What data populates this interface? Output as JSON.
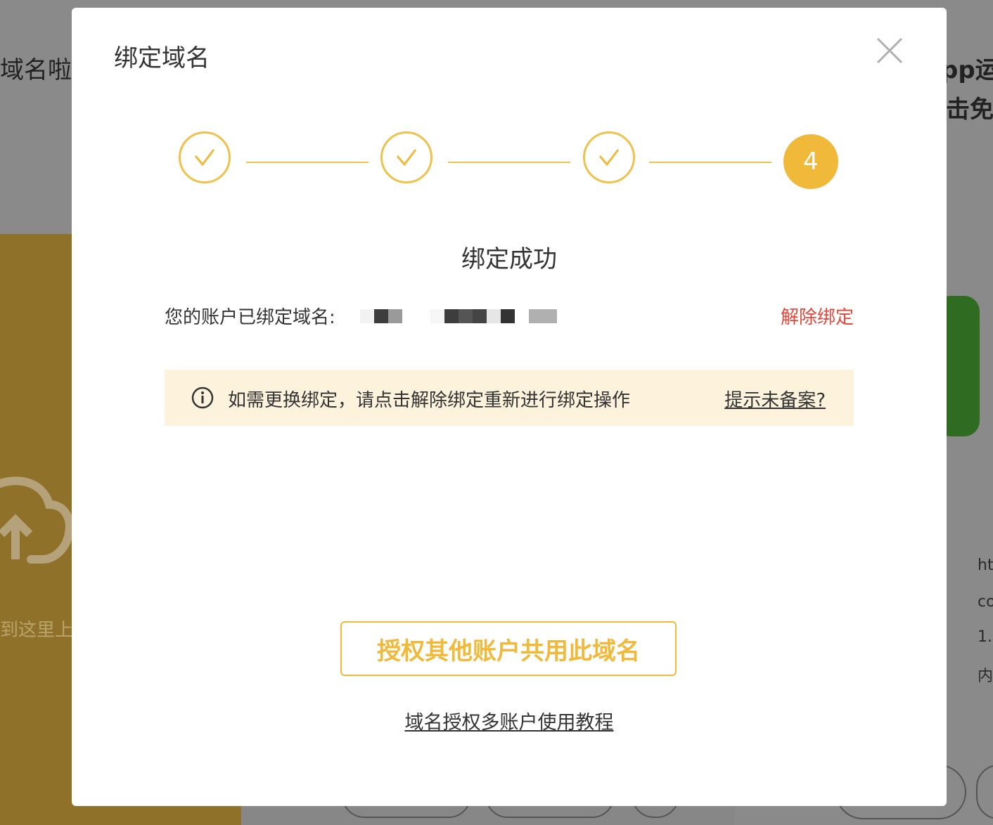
{
  "background": {
    "left_heading_fragment": "域名啦",
    "right_heading_fragment_1": "pp运",
    "right_heading_fragment_2": "击免",
    "upload_text_fragment": "到这里上传",
    "right_text_lines": [
      "ht",
      "co",
      "1.",
      "内"
    ]
  },
  "modal": {
    "title": "绑定域名",
    "close_icon": "close-icon",
    "steps": [
      {
        "state": "done",
        "icon": "checkmark-icon"
      },
      {
        "state": "done",
        "icon": "checkmark-icon"
      },
      {
        "state": "done",
        "icon": "checkmark-icon"
      },
      {
        "state": "current",
        "label": "4"
      }
    ],
    "success_title": "绑定成功",
    "bound_label": "您的账户已绑定域名:",
    "unbind_label": "解除绑定",
    "notice": {
      "icon": "info-icon",
      "text": "如需更换绑定，请点击解除绑定重新进行绑定操作",
      "link": "提示未备案?"
    },
    "share_button": "授权其他账户共用此域名",
    "tutorial_link": "域名授权多账户使用教程"
  },
  "colors": {
    "accent": "#f0b93a",
    "danger": "#e4463a",
    "notice_bg": "#fdf3dc"
  }
}
